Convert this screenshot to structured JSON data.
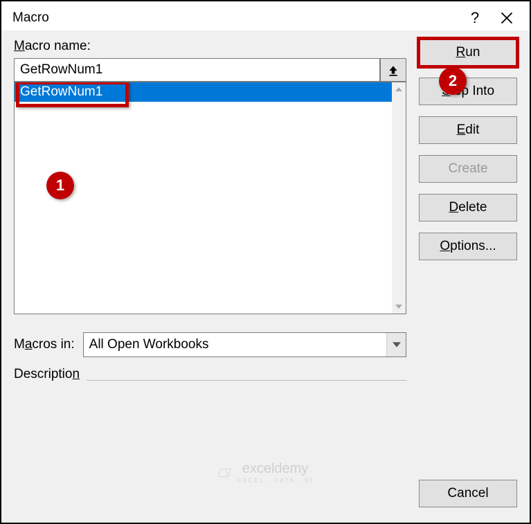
{
  "titlebar": {
    "title": "Macro",
    "help_tooltip": "?",
    "close_tooltip": "×"
  },
  "labels": {
    "macro_name": "Macro name:",
    "macros_in": "Macros in:",
    "description": "Description"
  },
  "inputs": {
    "macro_name_value": "GetRowNum1",
    "macros_in_value": "All Open Workbooks"
  },
  "list": {
    "items": [
      "GetRowNum1"
    ],
    "selected_index": 0
  },
  "buttons": {
    "run": "Run",
    "step_into": "Step Into",
    "edit": "Edit",
    "create": "Create",
    "delete": "Delete",
    "options": "Options...",
    "cancel": "Cancel"
  },
  "callouts": {
    "one": "1",
    "two": "2"
  },
  "watermark": {
    "text": "exceldemy",
    "sub": "EXCEL · DATA · BI"
  }
}
